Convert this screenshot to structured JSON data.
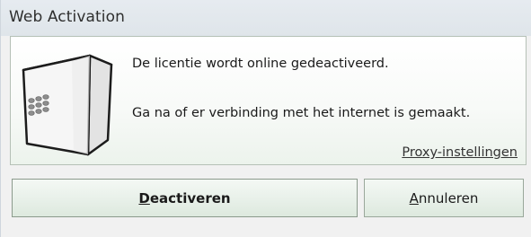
{
  "window": {
    "title": "Web Activation"
  },
  "message": {
    "line1": "De licentie wordt online gedeactiveerd.",
    "line2": "Ga na of er verbinding met het internet is gemaakt."
  },
  "links": {
    "proxy_label": "Proxy-instellingen"
  },
  "buttons": {
    "deactivate_accel": "D",
    "deactivate_rest": "eactiveren",
    "cancel_accel": "A",
    "cancel_rest": "nnuleren"
  },
  "icons": {
    "device": "hardware-device-icon"
  },
  "colors": {
    "titlebar": "#e2e8ed",
    "panel_gradient_bottom": "#ecf3ec",
    "button_border": "#9aa89b"
  }
}
